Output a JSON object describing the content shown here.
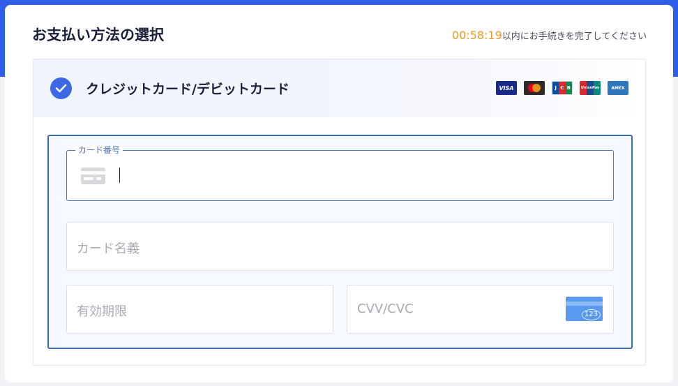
{
  "page": {
    "title": "お支払い方法の選択",
    "timer": {
      "time": "00:58:19",
      "suffix": "以内にお手続きを完了してください"
    }
  },
  "payment_method": {
    "label": "クレジットカード/デビットカード",
    "selected": true,
    "brands": [
      {
        "name": "VISA",
        "icon": "visa-logo"
      },
      {
        "name": "Mastercard",
        "icon": "mastercard-logo"
      },
      {
        "name": "JCB",
        "icon": "jcb-logo"
      },
      {
        "name": "UnionPay",
        "icon": "unionpay-logo"
      },
      {
        "name": "AMEX",
        "icon": "amex-logo"
      }
    ],
    "brand_text": {
      "visa": "VISA",
      "jcb": [
        "J",
        "C",
        "B"
      ],
      "unionpay": "UnionPay",
      "amex": "AMEX"
    }
  },
  "form": {
    "card_number": {
      "label": "カード番号",
      "value": "",
      "icon": "credit-card-icon"
    },
    "card_name": {
      "placeholder": "カード名義",
      "value": ""
    },
    "expiry": {
      "placeholder": "有効期限",
      "value": ""
    },
    "cvv": {
      "placeholder": "CVV/CVC",
      "value": "",
      "hint_number": "123",
      "icon": "cvv-card-icon"
    }
  },
  "colors": {
    "accent": "#3c68e6",
    "brand_band": "#2f5ee8",
    "timer": "#f29a1f",
    "form_border": "#3d6bb4",
    "title_text": "#1b1f3b",
    "placeholder": "#a7abb3"
  }
}
